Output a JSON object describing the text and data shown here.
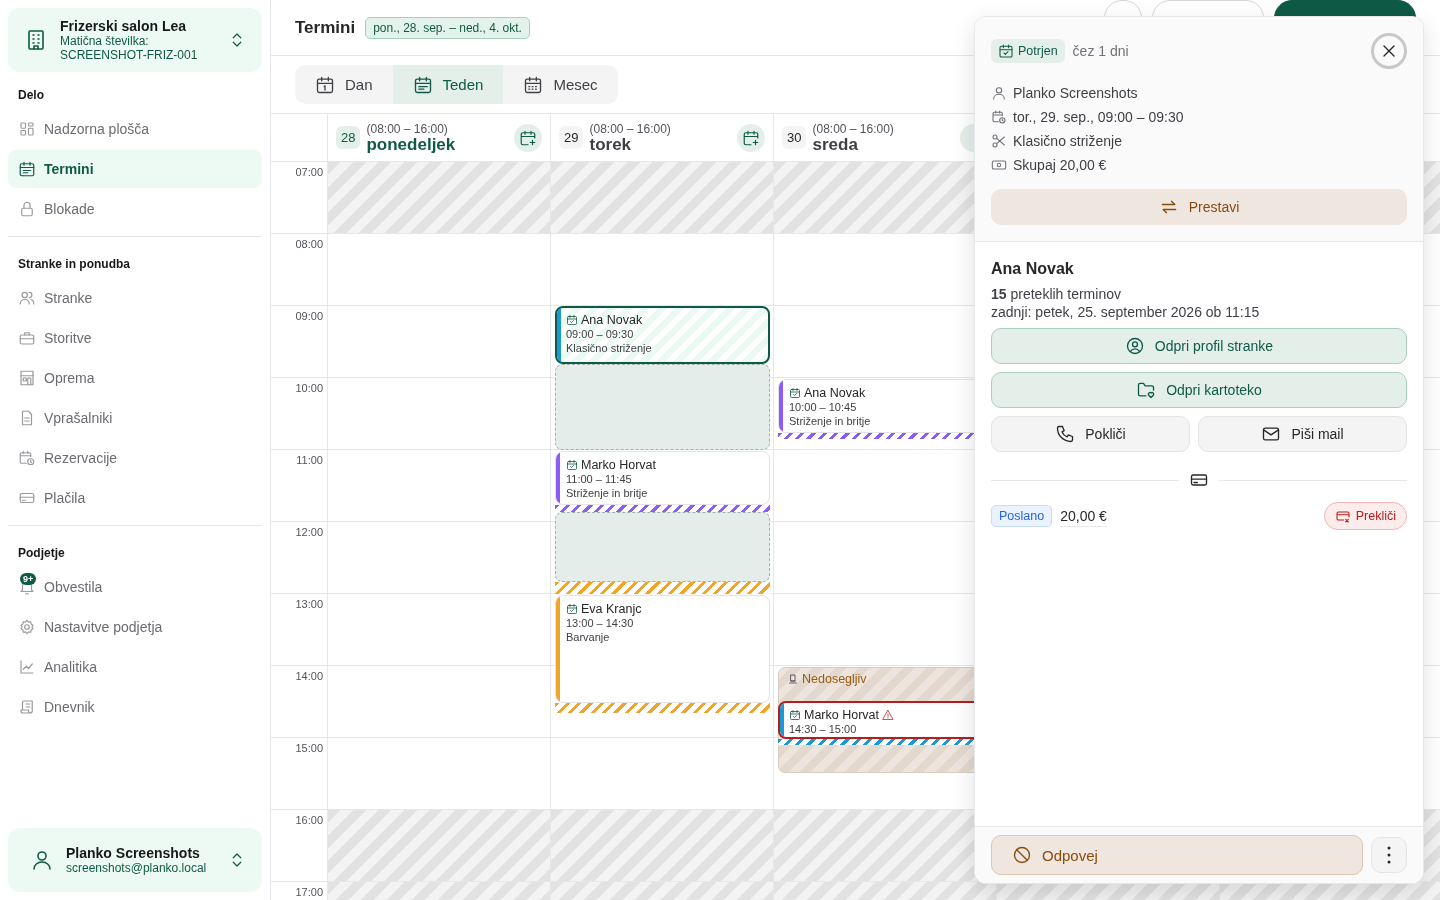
{
  "sidebar": {
    "company": {
      "name": "Frizerski salon Lea",
      "subtitle": "Matična številka: SCREENSHOT-FRIZ-001"
    },
    "sections": [
      {
        "title": "Delo",
        "items": [
          {
            "label": "Nadzorna plošča",
            "selected": false
          },
          {
            "label": "Termini",
            "selected": true
          },
          {
            "label": "Blokade",
            "selected": false
          }
        ]
      },
      {
        "title": "Stranke in ponudba",
        "items": [
          {
            "label": "Stranke",
            "selected": false
          },
          {
            "label": "Storitve",
            "selected": false
          },
          {
            "label": "Oprema",
            "selected": false
          },
          {
            "label": "Vprašalniki",
            "selected": false
          },
          {
            "label": "Rezervacije",
            "selected": false
          },
          {
            "label": "Plačila",
            "selected": false
          }
        ]
      },
      {
        "title": "Podjetje",
        "items": [
          {
            "label": "Obvestila",
            "selected": false,
            "badge": "9+"
          },
          {
            "label": "Nastavitve podjetja",
            "selected": false
          },
          {
            "label": "Analitika",
            "selected": false
          },
          {
            "label": "Dnevnik",
            "selected": false
          }
        ]
      }
    ],
    "user": {
      "name": "Planko Screenshots",
      "email": "screenshots@planko.local"
    }
  },
  "header": {
    "title": "Termini",
    "range": "pon., 28. sep. – ned., 4. okt."
  },
  "view_tabs": [
    {
      "label": "Dan",
      "selected": false
    },
    {
      "label": "Teden",
      "selected": true
    },
    {
      "label": "Mesec",
      "selected": false
    }
  ],
  "calendar": {
    "hours": [
      {
        "label": "07:00",
        "closed": true
      },
      {
        "label": "08:00",
        "closed": false
      },
      {
        "label": "09:00",
        "closed": false
      },
      {
        "label": "10:00",
        "closed": false
      },
      {
        "label": "11:00",
        "closed": false
      },
      {
        "label": "12:00",
        "closed": false
      },
      {
        "label": "13:00",
        "closed": false
      },
      {
        "label": "14:00",
        "closed": false
      },
      {
        "label": "15:00",
        "closed": false
      },
      {
        "label": "16:00",
        "closed": true
      },
      {
        "label": "17:00",
        "closed": true
      }
    ],
    "days": [
      {
        "number": "28",
        "hours": "(08:00 – 16:00)",
        "name": "ponedeljek",
        "today": true
      },
      {
        "number": "29",
        "hours": "(08:00 – 16:00)",
        "name": "torek",
        "today": false,
        "events": [
          {
            "kind": "appointment",
            "name": "Ana Novak",
            "time": "09:00 – 09:30",
            "service": "Klasično striženje",
            "color": "#1b9ad2",
            "selected": true,
            "conflict": false
          },
          {
            "kind": "pause"
          },
          {
            "kind": "appointment",
            "name": "Marko Horvat",
            "time": "11:00 – 11:45",
            "service": "Striženje in britje",
            "color": "#8b5cf6",
            "selected": false,
            "conflict": false
          },
          {
            "kind": "stripe",
            "color": "#8b5cf6"
          },
          {
            "kind": "pause"
          },
          {
            "kind": "stripe",
            "color": "#f0a52a"
          },
          {
            "kind": "appointment",
            "name": "Eva Kranjc",
            "time": "13:00 – 14:30",
            "service": "Barvanje",
            "color": "#f0a52a",
            "selected": false,
            "conflict": false
          },
          {
            "kind": "stripe",
            "color": "#f0a52a"
          }
        ]
      },
      {
        "number": "30",
        "hours": "(08:00 – 16:00)",
        "name": "sreda",
        "today": false,
        "events": [
          {
            "kind": "appointment",
            "name": "Ana Novak",
            "time": "10:00 – 10:45",
            "service": "Striženje in britje",
            "color": "#8b5cf6",
            "selected": false,
            "conflict": false
          },
          {
            "kind": "stripe",
            "color": "#8b5cf6"
          },
          {
            "kind": "block",
            "label": "Nedosegljiv"
          },
          {
            "kind": "appointment",
            "name": "Marko Horvat",
            "time": "14:30 – 15:00",
            "color": "#1b9ad2",
            "selected": false,
            "conflict": true
          },
          {
            "kind": "stripe",
            "color": "#1b9ad2"
          }
        ]
      }
    ]
  },
  "popover": {
    "status": {
      "label": "Potrjen",
      "when": "čez 1 dni"
    },
    "details": [
      {
        "kind": "person",
        "text": "Planko Screenshots"
      },
      {
        "kind": "datetime",
        "text": "tor., 29. sep., 09:00 – 09:30"
      },
      {
        "kind": "service",
        "text": "Klasično striženje"
      },
      {
        "kind": "price",
        "text": "Skupaj 20,00 €"
      }
    ],
    "reschedule": "Prestavi",
    "client": {
      "name": "Ana Novak",
      "visits": "**15** preteklih terminov",
      "last": "zadnji: petek, 25. september 2026 ob 11:15"
    },
    "actions": [
      {
        "kind": "profile",
        "label": "Odpri profil stranke"
      },
      {
        "kind": "folder",
        "label": "Odpri kartoteko"
      }
    ],
    "contact": [
      {
        "kind": "phone",
        "label": "Pokliči"
      },
      {
        "kind": "mail",
        "label": "Piši mail"
      }
    ],
    "payment": {
      "status": "Poslano",
      "amount": "20,00 €",
      "cancel": "Prekliči"
    },
    "cancel": "Odpovej"
  }
}
